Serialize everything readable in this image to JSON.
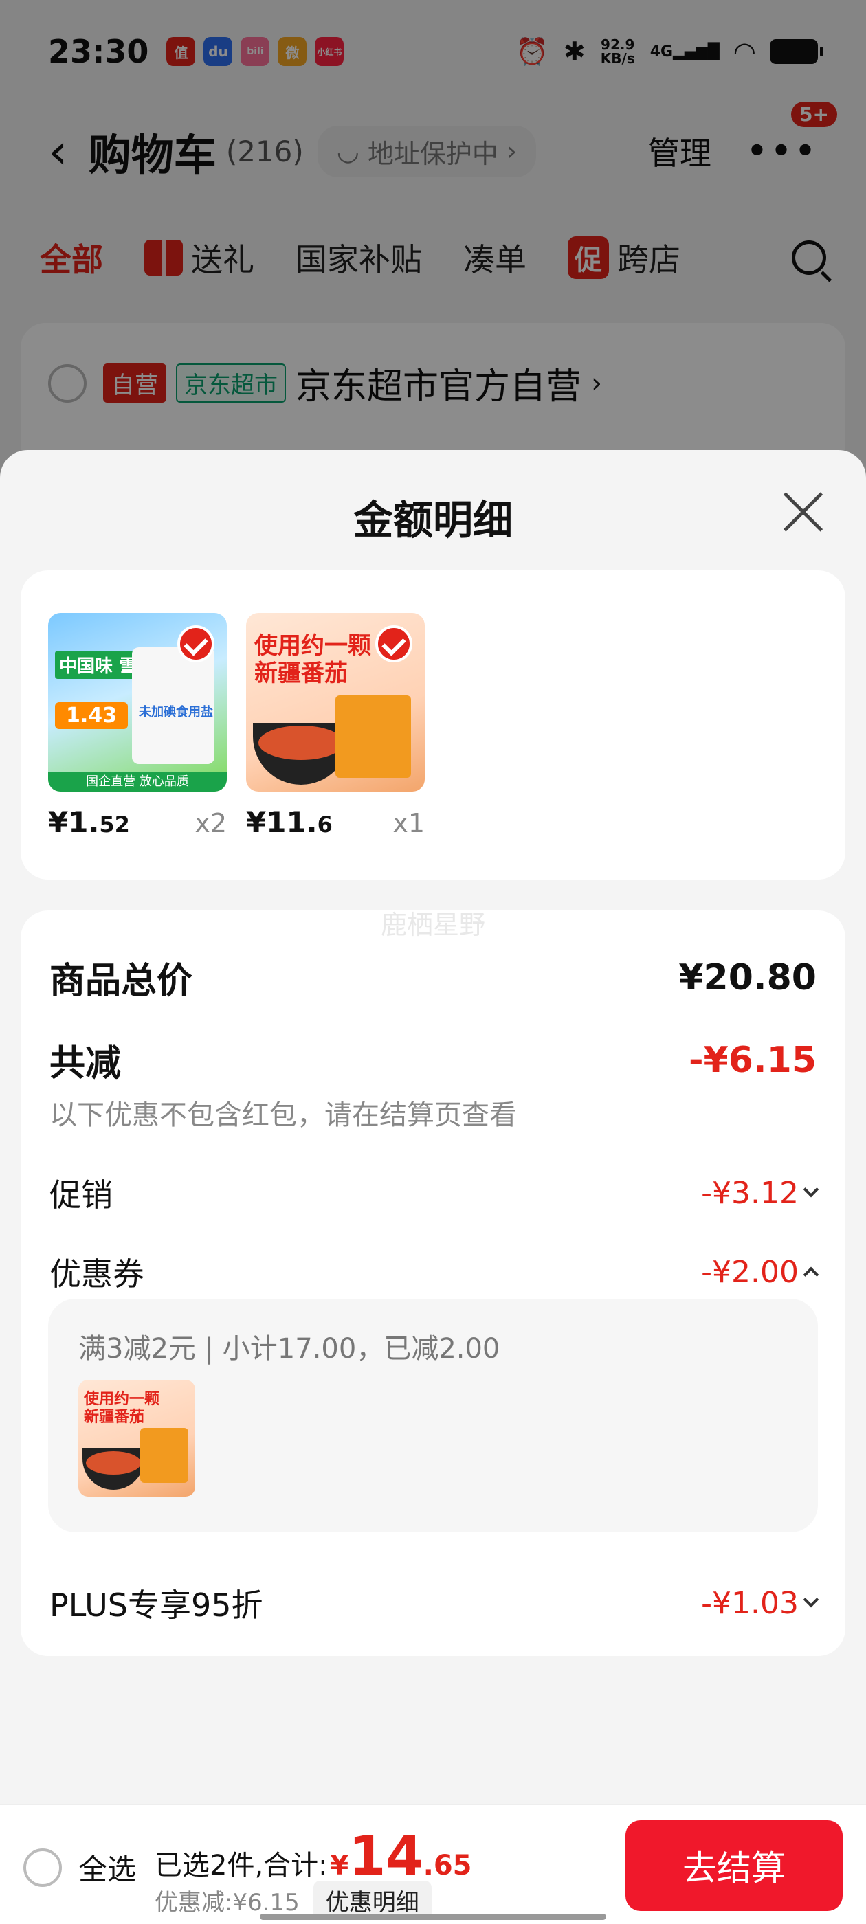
{
  "status_bar": {
    "time": "23:30",
    "app_icons": [
      {
        "glyph": "值",
        "color": "#e2231a"
      },
      {
        "glyph": "du",
        "color": "#2f6ff0"
      },
      {
        "glyph": "bili",
        "color": "#fb7299"
      },
      {
        "glyph": "微",
        "color": "#f5a623"
      },
      {
        "glyph": "小红书",
        "color": "#ff2442"
      }
    ],
    "net_speed_value": "92.9",
    "net_speed_unit": "KB/s",
    "signal": "4G"
  },
  "nav": {
    "title": "购物车",
    "count": "(216)",
    "address_status": "地址保护中",
    "manage": "管理",
    "badge": "5+"
  },
  "tabs": [
    "全部",
    "送礼",
    "国家补贴",
    "凑单",
    "促",
    "跨店"
  ],
  "store": {
    "tag_self": "自营",
    "tag_market": "京东超市",
    "name": "京东超市官方自营"
  },
  "sheet": {
    "title": "金额明细",
    "products": [
      {
        "price_int": "¥1.",
        "price_dec": "52",
        "qty": "x2",
        "img_head": "中国味 雪天盐",
        "img_label": "未加碘食用盐",
        "img_price": "1.43",
        "img_foot": "国企直营 放心品质"
      },
      {
        "price_int": "¥11.",
        "price_dec": "6",
        "qty": "x1",
        "img_head_line1": "使用约一颗",
        "img_head_line2": "新疆番茄"
      }
    ],
    "watermark": "鹿栖星野",
    "total_label": "商品总价",
    "total_value": "¥20.80",
    "reduce_label": "共减",
    "reduce_value": "-¥6.15",
    "reduce_note": "以下优惠不包含红包，请在结算页查看",
    "promo_label": "促销",
    "promo_value": "-¥3.12",
    "coupon_label": "优惠券",
    "coupon_value": "-¥2.00",
    "coupon_detail": "满3减2元 | 小计17.00，已减2.00",
    "coupon_thumb_line1": "使用约一颗",
    "coupon_thumb_line2": "新疆番茄",
    "plus_label": "PLUS专享95折",
    "plus_value": "-¥1.03"
  },
  "bottom": {
    "select_all": "全选",
    "total_label": "已选2件,合计:",
    "total_symbol": "¥",
    "total_int": "14",
    "total_dec": ".65",
    "discount_text": "优惠减:¥6.15",
    "detail_button": "优惠明细",
    "checkout": "去结算"
  },
  "colors": {
    "accent": "#e2231a",
    "checkout": "#f0182b"
  }
}
